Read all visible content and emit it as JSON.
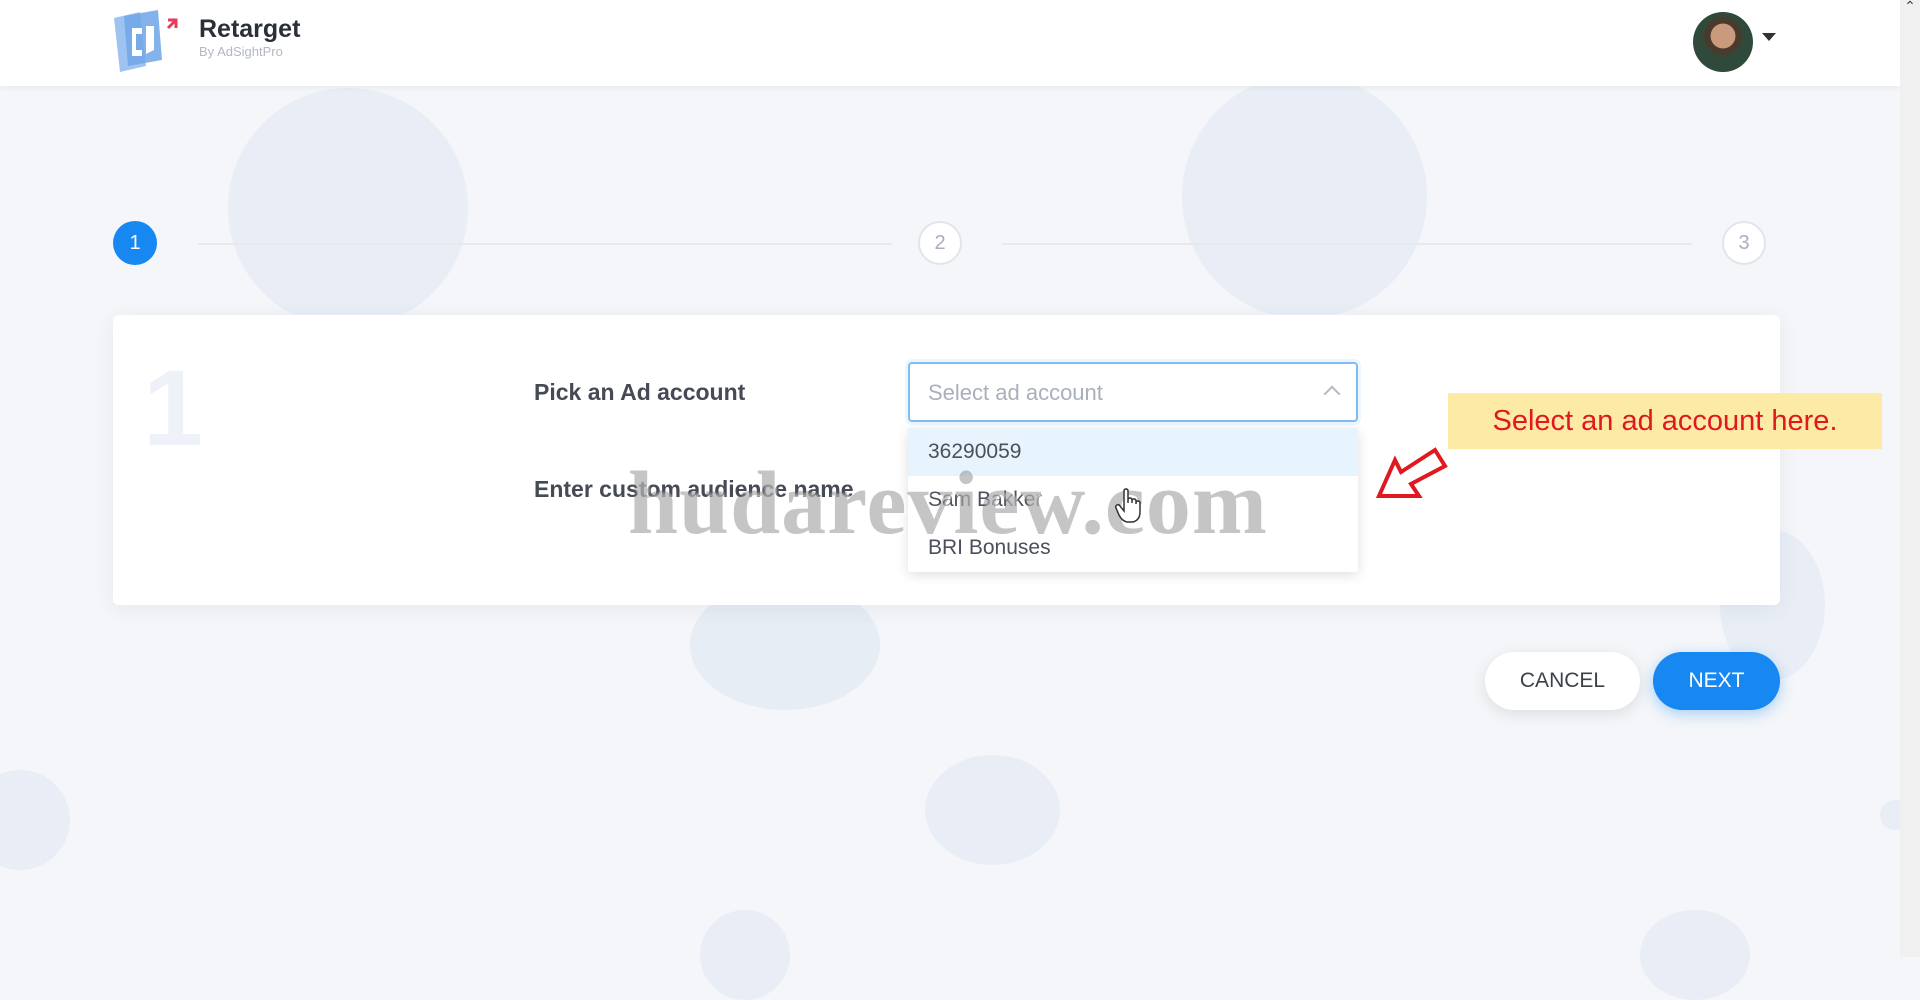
{
  "app": {
    "name": "Retarget",
    "subtitle": "By AdSightPro"
  },
  "stepper": {
    "steps": [
      "1",
      "2",
      "3"
    ],
    "active_step": 1
  },
  "card": {
    "step_number": "1",
    "ad_account_label": "Pick an Ad account",
    "audience_name_label": "Enter custom audience name"
  },
  "ad_account_select": {
    "placeholder": "Select ad account",
    "options": [
      "36290059",
      "Sam Bakker",
      "BRI Bonuses"
    ],
    "highlighted_index": 0
  },
  "actions": {
    "cancel_label": "CANCEL",
    "next_label": "NEXT"
  },
  "annotation": {
    "callout_text": "Select an ad account here."
  },
  "watermark": "hudareview.com",
  "colors": {
    "primary": "#1787f2",
    "callout_bg": "#fdeaa5",
    "callout_text": "#e0181f",
    "page_bg": "#f4f6f9"
  }
}
